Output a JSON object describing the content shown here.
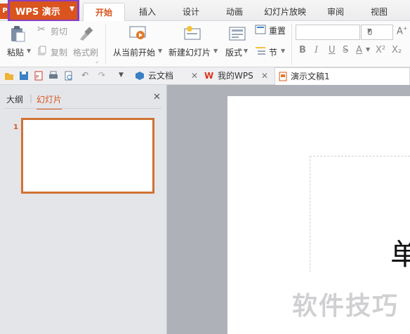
{
  "menubar": {
    "app_edge_glyph": "P",
    "app_button_label": "WPS 演示",
    "tabs": [
      "开始",
      "插入",
      "设计",
      "动画",
      "幻灯片放映",
      "审阅",
      "视图"
    ]
  },
  "ribbon": {
    "paste_label": "粘贴",
    "cut_label": "剪切",
    "copy_label": "复制",
    "format_painter_label": "格式刷",
    "from_current_label": "从当前开始",
    "new_slide_label": "新建幻灯片",
    "layout_label": "版式",
    "reset_label": "重置",
    "section_label": "节",
    "font_size_value": "0",
    "format_buttons": [
      "B",
      "I",
      "U",
      "S",
      "A",
      "X²",
      "X₂"
    ]
  },
  "qat": {
    "doc_tabs": [
      {
        "label": "云文档"
      },
      {
        "label": "我的WPS"
      },
      {
        "label": "演示文稿1"
      }
    ]
  },
  "left_panel": {
    "tabs": [
      "大纲",
      "幻灯片"
    ],
    "slide_numbers": [
      "1"
    ]
  },
  "slide": {
    "visible_char": "单"
  },
  "watermark": "软件技巧",
  "colors": {
    "brand": "#d9541e",
    "highlight_box": "#8a3fc2",
    "thumb_border": "#d07232",
    "workspace": "#aeb1b8"
  }
}
